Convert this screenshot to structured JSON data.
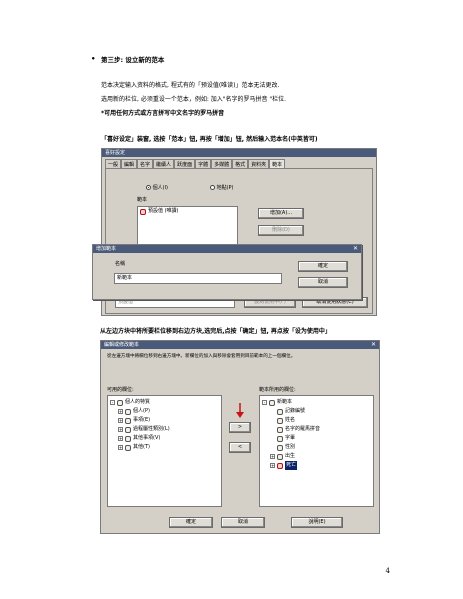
{
  "step": {
    "bullet": "•",
    "title": "第三步: 设立新的范本",
    "lines": [
      "范本决定输入资料的格式, 程式有的「预设值(唯读)」范本无法更改.",
      "选用新的栏位, 必须重设一个范本，例如: 加入\"名字的罗马拼音 \"栏位.",
      "*可用任何方式或方言拼写中文名字的罗马拼音"
    ]
  },
  "instruction1": "「喜好设定」装窗, 选按「范本」钮, 再按「增加」钮, 然后输入范本名(中英皆可)",
  "instruction2": "从左边方块中将所要栏位移到右边方块,选完后,点按「确定」钮, 再点按「设为使用中」",
  "pref_dialog": {
    "title": "喜好設定",
    "tabs": [
      "一般",
      "編輯",
      "名字",
      "繼續人",
      "跃度面",
      "字體",
      "多媒體",
      "格式",
      "資料夾",
      "範本"
    ],
    "radio_personal": "個人(I)",
    "radio_place": "地點(P)",
    "template_group_label": "範本",
    "template_item": "預設值 (唯讀)",
    "add_button": "增加(A)...",
    "delete_button": "刪除(D)",
    "edit_field_value": "預設值",
    "set_active_button": "設為使用中(F)",
    "cancel_active_button": "取消使用狀態(C)"
  },
  "new_template_dialog": {
    "title": "增加範本",
    "name_label": "名稱",
    "name_value": "新範本",
    "ok_button": "確定",
    "cancel_button": "取消"
  },
  "edit_dialog": {
    "title": "編輯或修改範本",
    "instruction": "從左邊方塊中將欄位移到右邊方塊中。新欄位的加入與移除會套用到目前範本的上一個欄位。",
    "available_label": "可用的欄位:",
    "template_fields_label": "範本所用的欄位:",
    "available_tree": [
      {
        "sign": "-",
        "label": "個人的特質",
        "indent": 0
      },
      {
        "sign": "+",
        "label": "個人(P)",
        "indent": 1
      },
      {
        "sign": "+",
        "label": "事項(E)",
        "indent": 1
      },
      {
        "sign": "+",
        "label": "過程屬性類別(L)",
        "indent": 1
      },
      {
        "sign": "+",
        "label": "其他事項(V)",
        "indent": 1
      },
      {
        "sign": "+",
        "label": "其他(T)",
        "indent": 1
      }
    ],
    "template_tree": [
      {
        "sign": "-",
        "label": "新範本",
        "indent": 0
      },
      {
        "sign": "",
        "label": "記錄編號",
        "indent": 1
      },
      {
        "sign": "",
        "label": "姓名",
        "indent": 1
      },
      {
        "sign": "",
        "label": "名字的羅馬拼音",
        "indent": 1
      },
      {
        "sign": "",
        "label": "字輩",
        "indent": 1
      },
      {
        "sign": "",
        "label": "性別",
        "indent": 1
      },
      {
        "sign": "+",
        "label": "出生",
        "indent": 1
      },
      {
        "sign": "+",
        "label": "死亡",
        "indent": 1
      }
    ],
    "add_arrow": ">",
    "remove_arrow": "<",
    "ok_button": "確定",
    "cancel_button": "取消",
    "help_button": "說明(E)"
  },
  "page_number": "4",
  "colors": {
    "titlebar": "#4a5a7a",
    "dialog_face": "#d4d0c8",
    "highlight": "#0a246a",
    "arrow_red": "#cc1111"
  }
}
